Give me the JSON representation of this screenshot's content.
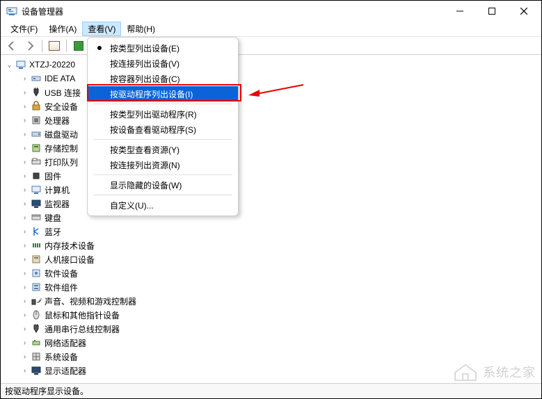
{
  "window": {
    "title": "设备管理器"
  },
  "menubar": {
    "file": "文件(F)",
    "action": "操作(A)",
    "view": "查看(V)",
    "help": "帮助(H)"
  },
  "tree": {
    "root": "XTZJ-20220",
    "items": [
      "IDE ATA",
      "USB 连接",
      "安全设备",
      "处理器",
      "磁盘驱动",
      "存储控制",
      "打印队列",
      "固件",
      "计算机",
      "监视器",
      "键盘",
      "蓝牙",
      "内存技术设备",
      "人机接口设备",
      "软件设备",
      "软件组件",
      "声音、视频和游戏控制器",
      "鼠标和其他指针设备",
      "通用串行总线控制器",
      "网络适配器",
      "系统设备",
      "显示适配器"
    ]
  },
  "dropdown": {
    "items": [
      "按类型列出设备(E)",
      "按连接列出设备(V)",
      "按容器列出设备(C)",
      "按驱动程序列出设备(I)",
      "按类型列出驱动程序(R)",
      "按设备查看驱动程序(S)",
      "按类型查看资源(Y)",
      "按连接列出资源(N)",
      "显示隐藏的设备(W)",
      "自定义(U)..."
    ],
    "checked_index": 0,
    "highlight_index": 3
  },
  "statusbar": {
    "text": "按驱动程序显示设备。"
  },
  "watermark": {
    "text": "系统之家"
  },
  "icons": {
    "help_glyph": "?"
  }
}
